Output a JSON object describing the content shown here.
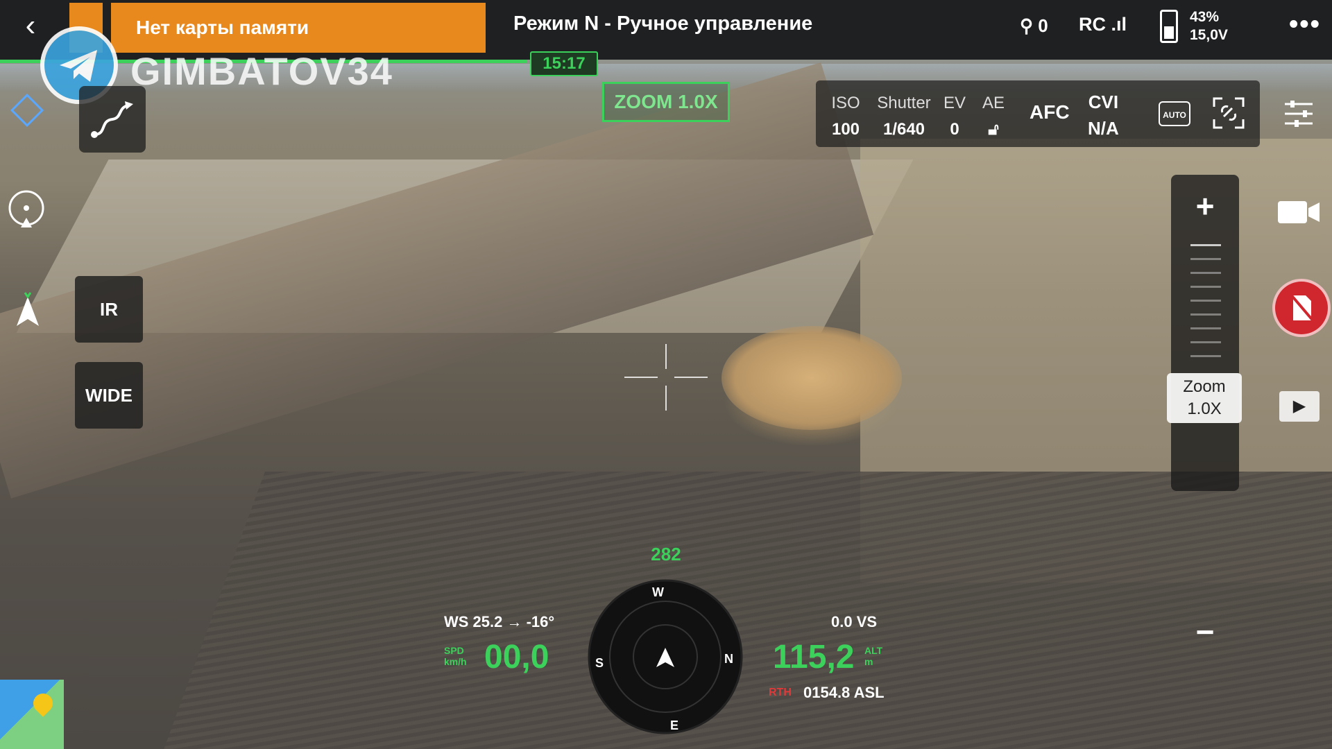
{
  "header": {
    "back_icon": "chevron-left-icon",
    "warning": "Нет карты памяти",
    "mode": "Режим N - Ручное управление",
    "satellites": "0",
    "rc_label": "RC",
    "battery_percent": "43%",
    "battery_voltage": "15,0V",
    "battery_level": 0.43,
    "more_icon": "more-icon",
    "flight_time": "15:17"
  },
  "watermark": {
    "text": "GIMBATOV34",
    "logo_icon": "telegram-icon"
  },
  "zoom_indicator": "ZOOM 1.0X",
  "camera": {
    "iso_label": "ISO",
    "iso_value": "100",
    "shutter_label": "Shutter",
    "shutter_value": "1/640",
    "ev_label": "EV",
    "ev_value": "0",
    "ae_label": "AE",
    "focus_mode": "AFC",
    "cvi_label": "CVI",
    "cvi_value": "N/A",
    "wb_mode": "AUTO"
  },
  "left_tools": {
    "ir_label": "IR",
    "wide_label": "WIDE"
  },
  "zoom_slider": {
    "plus": "+",
    "minus": "−",
    "label": "Zoom",
    "value": "1.0X"
  },
  "telemetry": {
    "heading": "282",
    "wind": "WS 25.2 → -16°",
    "speed_unit_top": "SPD",
    "speed_unit_bottom": "km/h",
    "speed": "00,0",
    "vs": "0.0   VS",
    "altitude": "115,2",
    "alt_unit_top": "ALT",
    "alt_unit_bottom": "m",
    "asl_tag": "RTH",
    "asl": "0154.8 ASL",
    "compass_labels": [
      "W",
      "N",
      "E",
      "S"
    ]
  },
  "colors": {
    "accent_green": "#3bd15a",
    "warning_orange": "#e8891e",
    "record_red": "#d0262e"
  }
}
